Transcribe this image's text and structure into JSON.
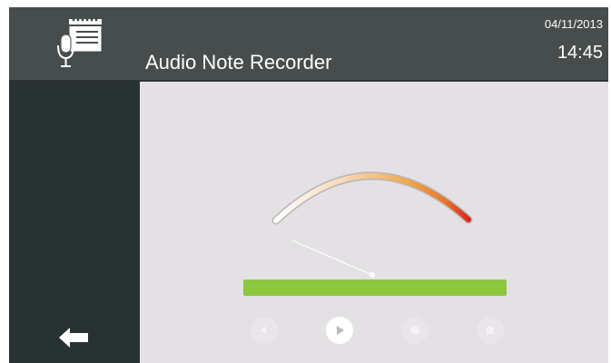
{
  "header": {
    "title": "Audio Note Recorder",
    "date": "04/11/2013",
    "time": "14:45",
    "app_icon": "notepad-microphone-icon"
  },
  "sidebar": {
    "back_icon": "arrow-left-icon"
  },
  "recorder": {
    "gauge_icon": "level-meter-gauge",
    "level_fraction": 1.0,
    "controls": [
      {
        "name": "rewind-icon",
        "enabled": false
      },
      {
        "name": "play-icon",
        "enabled": true
      },
      {
        "name": "record-icon",
        "enabled": false
      },
      {
        "name": "stop-icon",
        "enabled": false
      }
    ]
  },
  "colors": {
    "header_bg": "#474d4c",
    "sidebar_bg": "#293233",
    "content_bg": "#e4e1e4",
    "level_green": "#8dc63f",
    "gauge_low": "#ffffff",
    "gauge_mid": "#f0a54a",
    "gauge_high": "#d9261c"
  }
}
